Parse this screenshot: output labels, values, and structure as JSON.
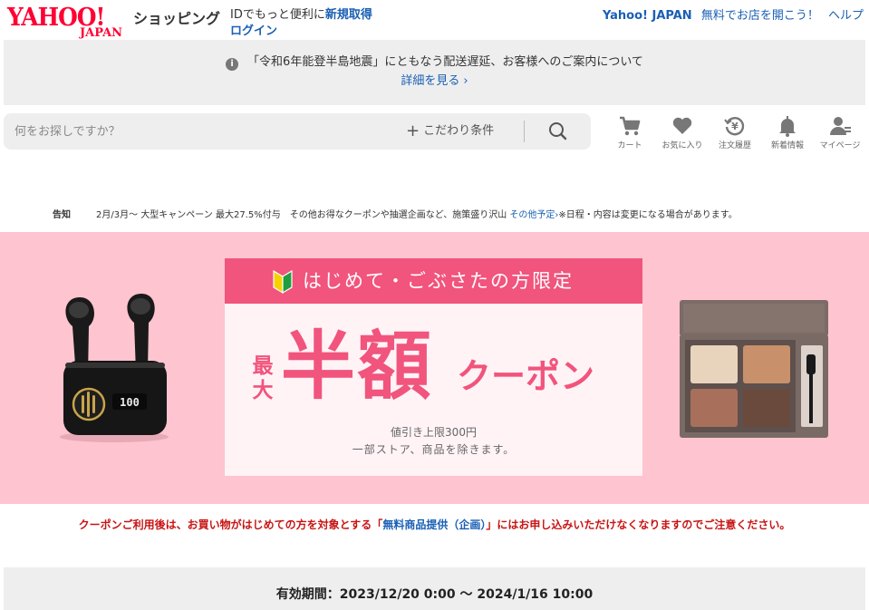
{
  "header": {
    "logo_text": "YAHOO!",
    "logo_sub": "JAPAN",
    "shop_name": "ショッピング",
    "id_prefix": "IDでもっと便利に",
    "signup": "新規取得",
    "login": "ログイン",
    "links": [
      "Yahoo! JAPAN",
      "無料でお店を開こう！",
      "ヘルプ"
    ]
  },
  "notice": {
    "text": "「令和6年能登半島地震」にともなう配送遅延、お客様へのご案内について",
    "link": "詳細を見る",
    "info_icon": "info-icon"
  },
  "search": {
    "placeholder": "何をお探しですか？",
    "filter_label": "こだわり条件",
    "button_icon": "search-icon"
  },
  "nav_icons": [
    {
      "icon": "cart-icon",
      "label": "カート"
    },
    {
      "icon": "heart-icon",
      "label": "お気に入り"
    },
    {
      "icon": "yen-history-icon",
      "label": "注文履歴"
    },
    {
      "icon": "bell-icon",
      "label": "新着情報"
    },
    {
      "icon": "user-icon",
      "label": "マイページ"
    }
  ],
  "announcement": {
    "tag": "告知",
    "text": "2月/3月～ 大型キャンペーン 最大27.5%付与　その他お得なクーポンや抽選企画など、施策盛り沢山",
    "link": "その他予定",
    "suffix": "※日程・内容は変更になる場合があります。"
  },
  "banner": {
    "head": "はじめて・ごぶさたの方限定",
    "prefix": "最大",
    "main": "半額",
    "suffix": "クーポン",
    "note1": "値引き上限300円",
    "note2": "一部ストア、商品を除きます。",
    "earbuds_display": "100",
    "colors": {
      "bg": "#fec4d0",
      "accent": "#f1547c"
    }
  },
  "warning": {
    "before": "クーポンご利用後は、お買い物がはじめての方を対象とする「",
    "link": "無料商品提供（企画）",
    "after": "」にはお申し込みいただけなくなりますのでご注意ください。"
  },
  "period": {
    "text": "有効期間：2023/12/20 0:00 〜 2024/1/16 10:00"
  }
}
